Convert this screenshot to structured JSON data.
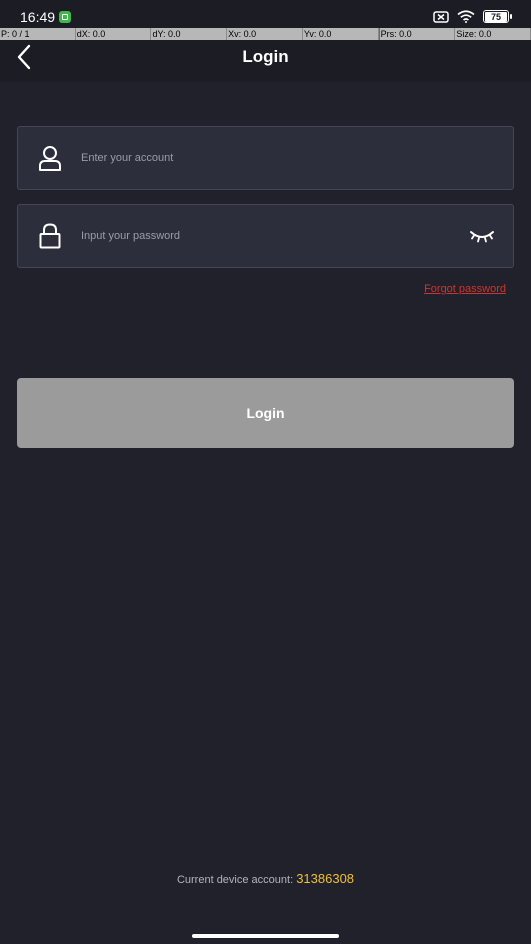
{
  "status_bar": {
    "time": "16:49",
    "battery_level": "75",
    "icons": [
      "app-notification-icon",
      "sim-blocked-icon",
      "wifi-icon",
      "battery-icon"
    ]
  },
  "debug_bar": {
    "cells": [
      "P: 0 / 1",
      "dX: 0.0",
      "dY: 0.0",
      "Xv: 0.0",
      "Yv: 0.0",
      "Prs: 0.0",
      "Size: 0.0"
    ]
  },
  "header": {
    "title": "Login",
    "back_icon": "chevron-left-icon"
  },
  "form": {
    "account_placeholder": "Enter your account",
    "account_value": "",
    "password_placeholder": "Input your password",
    "password_value": "",
    "forgot_password": "Forgot password",
    "login_label": "Login"
  },
  "footer": {
    "device_account_label": "Current device account:",
    "device_account_number": "31386308"
  },
  "colors": {
    "background": "#20212b",
    "header": "#1b1c24",
    "input_bg": "#2d2e3b",
    "button_disabled": "#9b9b9b",
    "link_red": "#d0342c",
    "account_yellow": "#f0c030"
  }
}
